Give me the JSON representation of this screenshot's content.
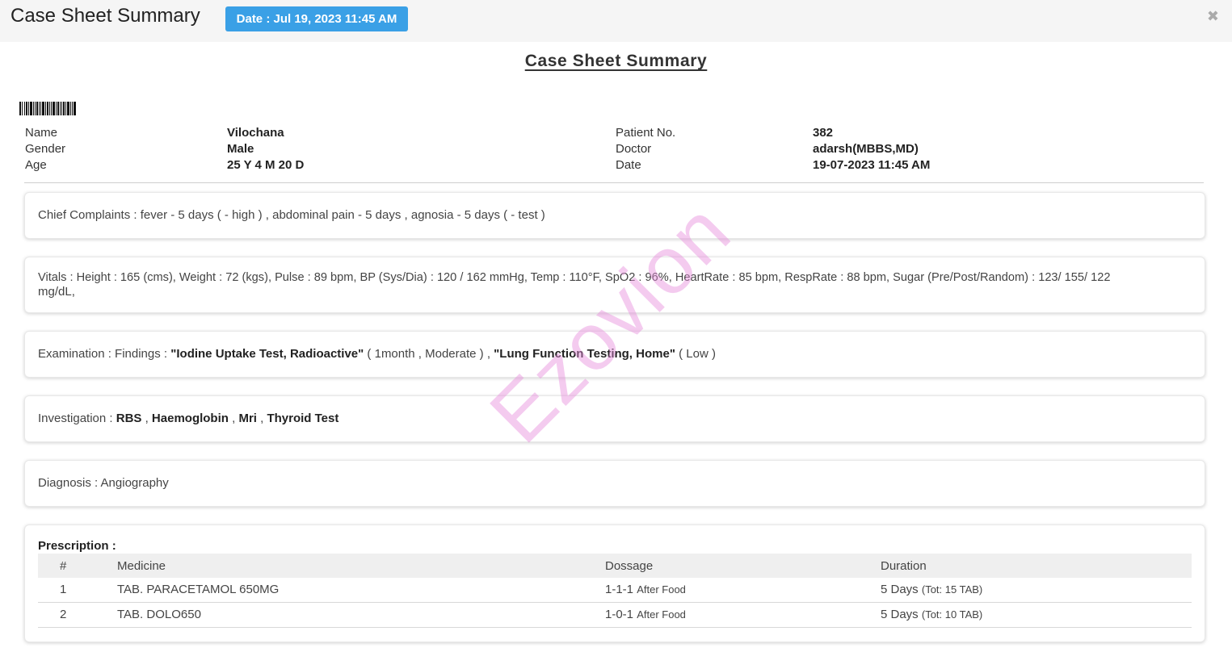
{
  "header": {
    "title": "Case Sheet Summary",
    "date_badge": "Date : Jul 19, 2023 11:45 AM",
    "close_icon": "close-icon",
    "badge_color": "#3aa0e6"
  },
  "document": {
    "title": "Case Sheet Summary"
  },
  "patient": {
    "name_label": "Name",
    "name_value": "Vilochana",
    "gender_label": "Gender",
    "gender_value": "Male",
    "age_label": "Age",
    "age_value": "25 Y 4 M 20 D",
    "patient_no_label": "Patient No.",
    "patient_no_value": "382",
    "doctor_label": "Doctor",
    "doctor_value": "adarsh(MBBS,MD)",
    "date_label": "Date",
    "date_value": "19-07-2023 11:45 AM"
  },
  "chief_complaints": {
    "text": "Chief Complaints : fever - 5 days ( - high ) , abdominal pain - 5 days , agnosia - 5 days ( - test )"
  },
  "vitals": {
    "line1": "Vitals : Height : 165 (cms), Weight : 72 (kgs), Pulse : 89 bpm, BP (Sys/Dia) : 120 / 162 mmHg, Temp : 110°F, SpO2 : 96%, HeartRate : 85 bpm, RespRate : 88 bpm, Sugar (Pre/Post/Random) : 123/ 155/ 122",
    "line2": "mg/dL,"
  },
  "examination": {
    "prefix": "Examination : Findings : ",
    "finding1_name": "\"Iodine Uptake Test, Radioactive\"",
    "finding1_detail": " ( 1month , Moderate ) , ",
    "finding2_name": "\"Lung Function Testing, Home\"",
    "finding2_detail": " ( Low )"
  },
  "investigation": {
    "prefix": "Investigation : ",
    "item1": "RBS",
    "sep1": " , ",
    "item2": "Haemoglobin",
    "sep2": " , ",
    "item3": "Mri",
    "sep3": " , ",
    "item4": "Thyroid Test"
  },
  "diagnosis": {
    "text": "Diagnosis : Angiography"
  },
  "prescription": {
    "title": "Prescription :",
    "headers": [
      "#",
      "Medicine",
      "Dossage",
      "Duration"
    ],
    "rows": [
      {
        "num": "1",
        "medicine": "TAB. PARACETAMOL 650MG",
        "dose": "1-1-1",
        "dose_note": "After Food",
        "duration": "5 Days",
        "duration_note": "(Tot: 15 TAB)"
      },
      {
        "num": "2",
        "medicine": "TAB. DOLO650",
        "dose": "1-0-1",
        "dose_note": "After Food",
        "duration": "5 Days",
        "duration_note": "(Tot: 10 TAB)"
      }
    ]
  },
  "watermark": {
    "text": "Ezovion",
    "color": "#e68cdc"
  }
}
